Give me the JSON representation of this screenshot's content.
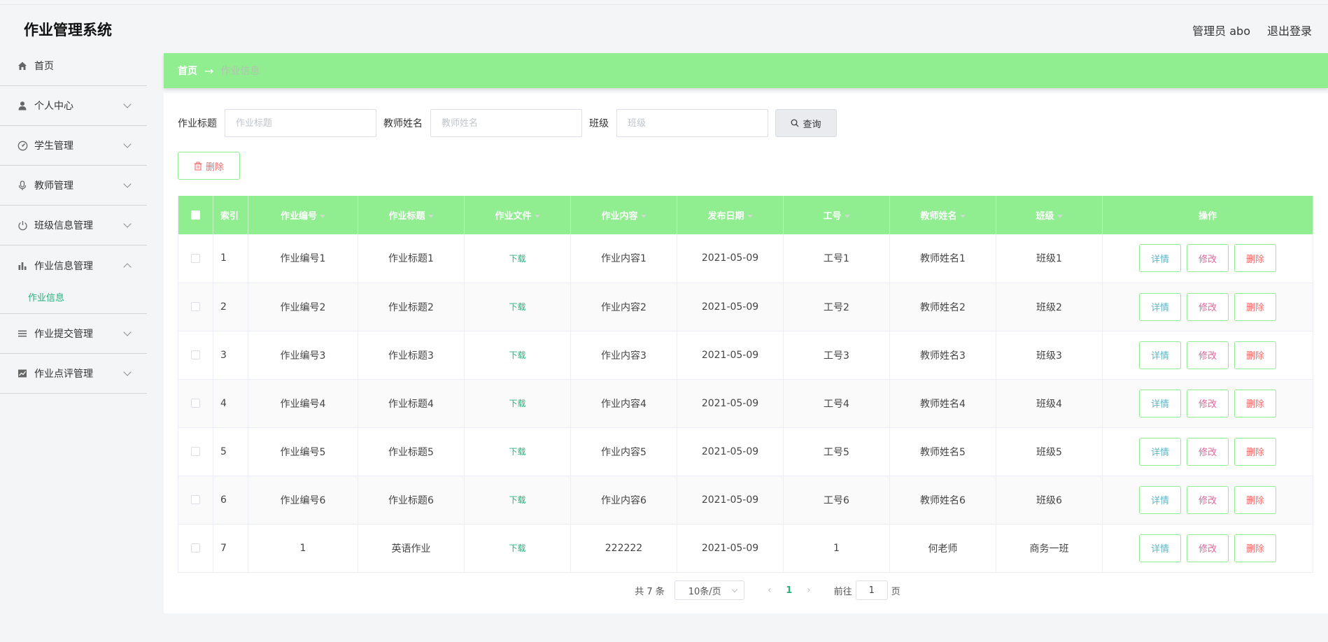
{
  "app": {
    "title": "作业管理系统"
  },
  "header": {
    "user": "管理员 abo",
    "logout": "退出登录"
  },
  "sidebar": {
    "items": [
      {
        "label": "首页",
        "icon": "home-icon"
      },
      {
        "label": "个人中心",
        "icon": "user-icon"
      },
      {
        "label": "学生管理",
        "icon": "dashboard-icon"
      },
      {
        "label": "教师管理",
        "icon": "microphone-icon"
      },
      {
        "label": "班级信息管理",
        "icon": "power-icon"
      },
      {
        "label": "作业信息管理",
        "icon": "bar-chart-icon"
      },
      {
        "label": "作业提交管理",
        "icon": "list-icon"
      },
      {
        "label": "作业点评管理",
        "icon": "line-chart-icon"
      }
    ],
    "submenu": {
      "label": "作业信息"
    }
  },
  "breadcrumb": {
    "home": "首页",
    "separator": "→",
    "current": "作业信息"
  },
  "search": {
    "title_label": "作业标题",
    "title_placeholder": "作业标题",
    "teacher_label": "教师姓名",
    "teacher_placeholder": "教师姓名",
    "class_label": "班级",
    "class_placeholder": "班级",
    "query_button": "查询"
  },
  "actions": {
    "delete_batch": "删除"
  },
  "table": {
    "columns": [
      "索引",
      "作业编号",
      "作业标题",
      "作业文件",
      "作业内容",
      "发布日期",
      "工号",
      "教师姓名",
      "班级",
      "操作"
    ],
    "rows": [
      {
        "index": "1",
        "code": "作业编号1",
        "title": "作业标题1",
        "file": "下载",
        "content": "作业内容1",
        "date": "2021-05-09",
        "staff_id": "工号1",
        "teacher": "教师姓名1",
        "class": "班级1"
      },
      {
        "index": "2",
        "code": "作业编号2",
        "title": "作业标题2",
        "file": "下载",
        "content": "作业内容2",
        "date": "2021-05-09",
        "staff_id": "工号2",
        "teacher": "教师姓名2",
        "class": "班级2"
      },
      {
        "index": "3",
        "code": "作业编号3",
        "title": "作业标题3",
        "file": "下载",
        "content": "作业内容3",
        "date": "2021-05-09",
        "staff_id": "工号3",
        "teacher": "教师姓名3",
        "class": "班级3"
      },
      {
        "index": "4",
        "code": "作业编号4",
        "title": "作业标题4",
        "file": "下载",
        "content": "作业内容4",
        "date": "2021-05-09",
        "staff_id": "工号4",
        "teacher": "教师姓名4",
        "class": "班级4"
      },
      {
        "index": "5",
        "code": "作业编号5",
        "title": "作业标题5",
        "file": "下载",
        "content": "作业内容5",
        "date": "2021-05-09",
        "staff_id": "工号5",
        "teacher": "教师姓名5",
        "class": "班级5"
      },
      {
        "index": "6",
        "code": "作业编号6",
        "title": "作业标题6",
        "file": "下载",
        "content": "作业内容6",
        "date": "2021-05-09",
        "staff_id": "工号6",
        "teacher": "教师姓名6",
        "class": "班级6"
      },
      {
        "index": "7",
        "code": "1",
        "title": "英语作业",
        "file": "下载",
        "content": "222222",
        "date": "2021-05-09",
        "staff_id": "1",
        "teacher": "何老师",
        "class": "商务一班"
      }
    ],
    "row_actions": {
      "detail": "详情",
      "edit": "修改",
      "delete": "删除"
    }
  },
  "pagination": {
    "total": "共 7 条",
    "page_size": "10条/页",
    "prev": "‹",
    "current_page": "1",
    "next": "›",
    "goto_prefix": "前往",
    "goto_value": "1",
    "goto_suffix": "页"
  },
  "colors": {
    "accent_green": "#90ee90",
    "link_green": "#28b07c",
    "danger": "#f56c6c",
    "edit_pink": "#e0669c",
    "detail_teal": "#5bb7c7"
  }
}
